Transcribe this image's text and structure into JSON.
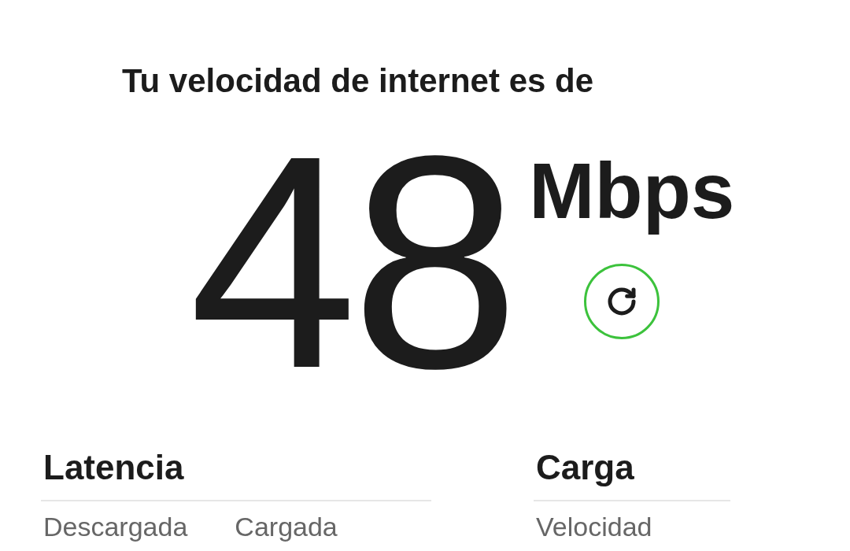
{
  "heading": "Tu velocidad de internet es de",
  "speed": {
    "value": "48",
    "unit": "Mbps"
  },
  "refresh_button": {
    "kind": "refresh"
  },
  "sections": [
    {
      "title": "Latencia",
      "labels": [
        "Descargada",
        "Cargada"
      ]
    },
    {
      "title": "Carga",
      "labels": [
        "Velocidad"
      ]
    }
  ]
}
